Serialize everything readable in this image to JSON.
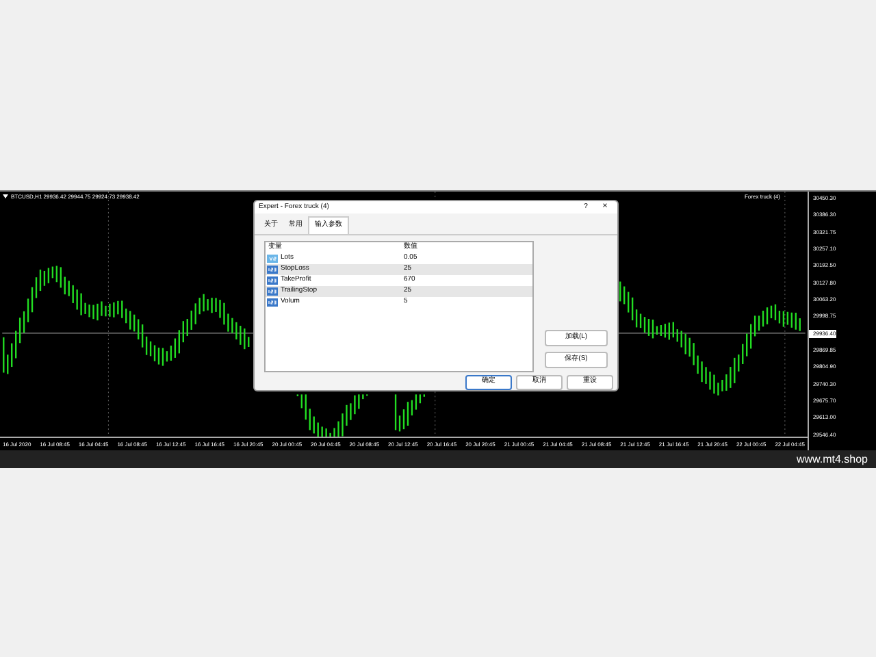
{
  "chart": {
    "symbol_info": "BTCUSD,H1  29936.42 29944.75 29924.73 29938.42",
    "expert_label": "Forex truck (4)",
    "price_labels": [
      {
        "text": "30450.30",
        "selected": false
      },
      {
        "text": "30386.30",
        "selected": false
      },
      {
        "text": "30321.75",
        "selected": false
      },
      {
        "text": "30257.10",
        "selected": false
      },
      {
        "text": "30192.50",
        "selected": false
      },
      {
        "text": "30127.80",
        "selected": false
      },
      {
        "text": "30063.20",
        "selected": false
      },
      {
        "text": "29998.75",
        "selected": false
      },
      {
        "text": "29936.40",
        "selected": true
      },
      {
        "text": "29869.85",
        "selected": false
      },
      {
        "text": "29804.90",
        "selected": false
      },
      {
        "text": "29740.30",
        "selected": false
      },
      {
        "text": "29675.70",
        "selected": false
      },
      {
        "text": "29613.00",
        "selected": false
      },
      {
        "text": "29546.40",
        "selected": false
      }
    ],
    "time_labels": [
      "16 Jul 2020",
      "16 Jul 08:45",
      "16 Jul 04:45",
      "16 Jul 08:45",
      "16 Jul 12:45",
      "16 Jul 16:45",
      "16 Jul 20:45",
      "20 Jul 00:45",
      "20 Jul 04:45",
      "20 Jul 08:45",
      "20 Jul 12:45",
      "20 Jul 16:45",
      "20 Jul 20:45",
      "21 Jul 00:45",
      "21 Jul 04:45",
      "21 Jul 08:45",
      "21 Jul 12:45",
      "21 Jul 16:45",
      "21 Jul 20:45",
      "22 Jul 00:45",
      "22 Jul 04:45"
    ]
  },
  "dialog": {
    "title": "Expert - Forex truck (4)",
    "help": "?",
    "close": "×",
    "tabs": [
      {
        "label": "关于",
        "selected": false
      },
      {
        "label": "常用",
        "selected": false
      },
      {
        "label": "输入参数",
        "selected": true
      }
    ],
    "columns": [
      "变量",
      "数值"
    ],
    "rows": [
      {
        "kind": "double",
        "name": "Lots",
        "value": "0.05"
      },
      {
        "kind": "int",
        "name": "StopLoss",
        "value": "25"
      },
      {
        "kind": "int",
        "name": "TakeProfit",
        "value": "670"
      },
      {
        "kind": "int",
        "name": "TrailingStop",
        "value": "25"
      },
      {
        "kind": "int",
        "name": "Volum",
        "value": "5"
      }
    ],
    "side_buttons": [
      "加载(L)",
      "保存(S)"
    ],
    "buttons": [
      "确定",
      "取消",
      "重设"
    ]
  },
  "footer": {
    "site": "www.mt4.shop"
  }
}
